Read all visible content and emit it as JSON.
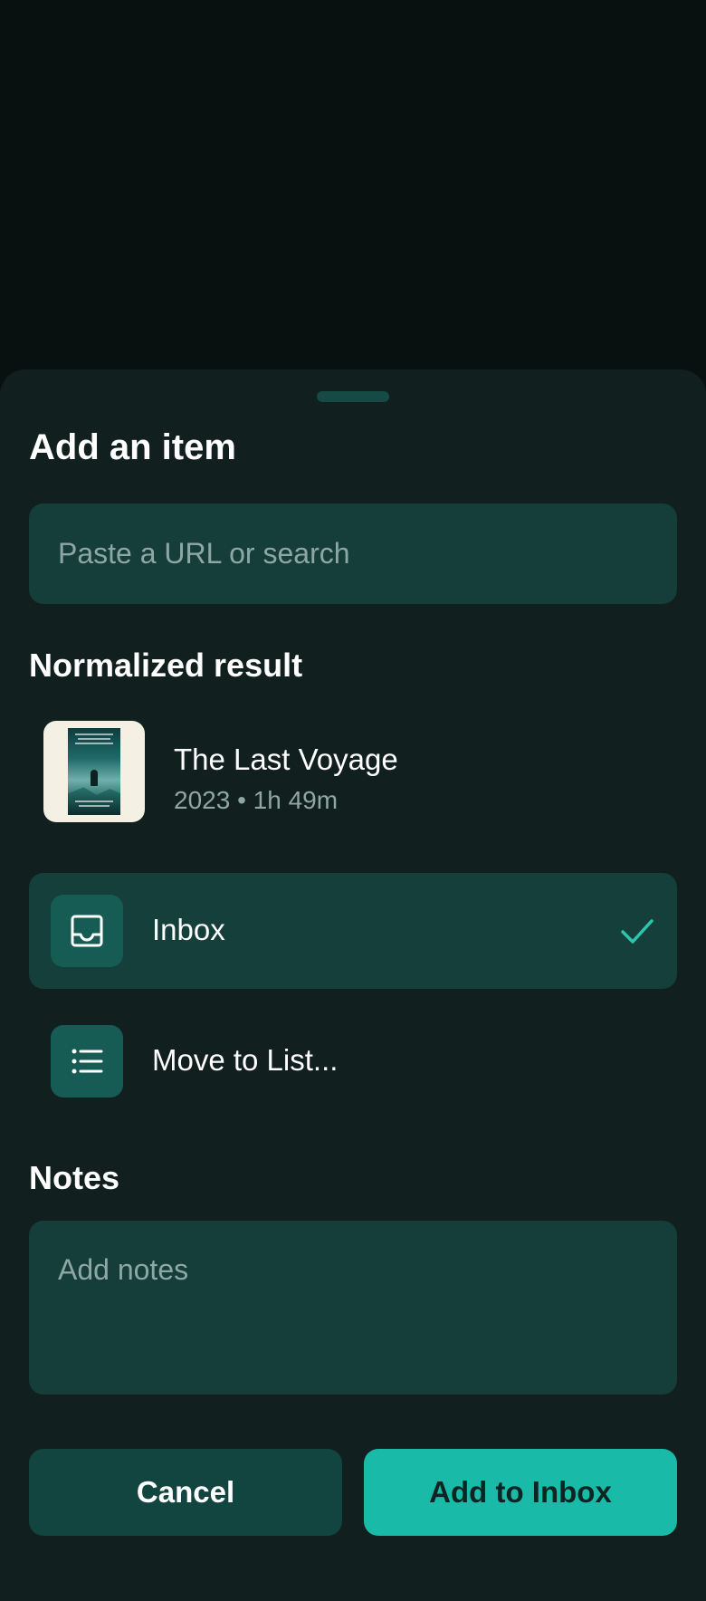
{
  "sheet": {
    "title": "Add an item"
  },
  "search": {
    "placeholder": "Paste a URL or search",
    "value": ""
  },
  "result": {
    "heading": "Normalized result",
    "title": "The Last Voyage",
    "meta": "2023 • 1h 49m",
    "poster_icon": "movie-poster-image"
  },
  "destinations": [
    {
      "label": "Inbox",
      "icon": "inbox-tray-icon",
      "selected": true,
      "indicator_icon": "check-icon"
    },
    {
      "label": "Move to List...",
      "icon": "list-icon",
      "selected": false
    }
  ],
  "notes": {
    "heading": "Notes",
    "placeholder": "Add notes",
    "value": ""
  },
  "actions": {
    "cancel_label": "Cancel",
    "submit_label": "Add to Inbox"
  },
  "colors": {
    "backdrop": "#081010",
    "sheet_background": "#111f1f",
    "field_background": "#153d3a",
    "selected_row": "#143f3b",
    "icon_box": "#175c54",
    "accent": "#1abaa8",
    "check_accent": "#2fc4ae",
    "muted_text": "#8fa6a2"
  }
}
